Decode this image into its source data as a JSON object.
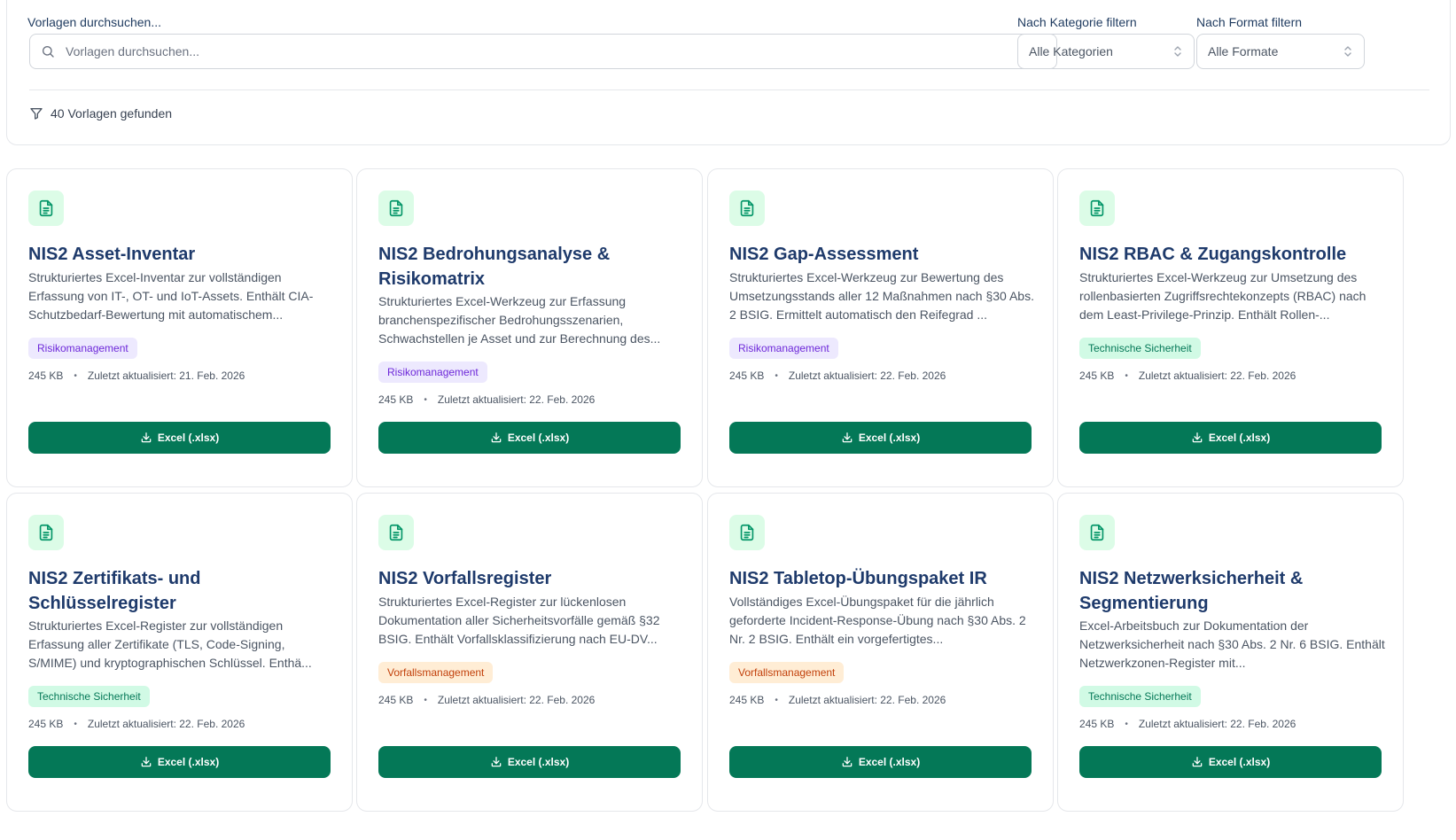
{
  "filters": {
    "search_label": "Vorlagen durchsuchen...",
    "search_placeholder": "Vorlagen durchsuchen...",
    "category_label": "Nach Kategorie filtern",
    "category_value": "Alle Kategorien",
    "format_label": "Nach Format filtern",
    "format_value": "Alle Formate",
    "result_count": "40 Vorlagen gefunden"
  },
  "colors": {
    "primary_button": "#047857",
    "title": "#1e3a6b",
    "icon_bg": "#dcfce7"
  },
  "cards": [
    {
      "title": "NIS2 Asset-Inventar",
      "description": "Strukturiertes Excel-Inventar zur vollständigen Erfassung von IT-, OT- und IoT-Assets. Enthält CIA-Schutzbedarf-Bewertung mit automatischem...",
      "category": "Risikomanagement",
      "size": "245 KB",
      "updated": "Zuletzt aktualisiert: 21. Feb. 2026",
      "button": "Excel (.xlsx)"
    },
    {
      "title": "NIS2 Bedrohungsanalyse & Risikomatrix",
      "description": "Strukturiertes Excel-Werkzeug zur Erfassung branchenspezifischer Bedrohungsszenarien, Schwachstellen je Asset und zur Berechnung des...",
      "category": "Risikomanagement",
      "size": "245 KB",
      "updated": "Zuletzt aktualisiert: 22. Feb. 2026",
      "button": "Excel (.xlsx)"
    },
    {
      "title": "NIS2 Gap-Assessment",
      "description": "Strukturiertes Excel-Werkzeug zur Bewertung des Umsetzungsstands aller 12 Maßnahmen nach §30 Abs. 2 BSIG. Ermittelt automatisch den Reifegrad ...",
      "category": "Risikomanagement",
      "size": "245 KB",
      "updated": "Zuletzt aktualisiert: 22. Feb. 2026",
      "button": "Excel (.xlsx)"
    },
    {
      "title": "NIS2 RBAC & Zugangskontrolle",
      "description": "Strukturiertes Excel-Werkzeug zur Umsetzung des rollenbasierten Zugriffsrechtekonzepts (RBAC) nach dem Least-Privilege-Prinzip. Enthält Rollen-...",
      "category": "Technische Sicherheit",
      "size": "245 KB",
      "updated": "Zuletzt aktualisiert: 22. Feb. 2026",
      "button": "Excel (.xlsx)"
    },
    {
      "title": "NIS2 Zertifikats- und Schlüsselregister",
      "description": "Strukturiertes Excel-Register zur vollständigen Erfassung aller Zertifikate (TLS, Code-Signing, S/MIME) und kryptographischen Schlüssel. Enthä...",
      "category": "Technische Sicherheit",
      "size": "245 KB",
      "updated": "Zuletzt aktualisiert: 22. Feb. 2026",
      "button": "Excel (.xlsx)"
    },
    {
      "title": "NIS2 Vorfallsregister",
      "description": "Strukturiertes Excel-Register zur lückenlosen Dokumentation aller Sicherheitsvorfälle gemäß §32 BSIG. Enthält Vorfallsklassifizierung nach EU-DV...",
      "category": "Vorfallsmanagement",
      "size": "245 KB",
      "updated": "Zuletzt aktualisiert: 22. Feb. 2026",
      "button": "Excel (.xlsx)"
    },
    {
      "title": "NIS2 Tabletop-Übungspaket IR",
      "description": "Vollständiges Excel-Übungspaket für die jährlich geforderte Incident-Response-Übung nach §30 Abs. 2 Nr. 2 BSIG. Enthält ein vorgefertigtes...",
      "category": "Vorfallsmanagement",
      "size": "245 KB",
      "updated": "Zuletzt aktualisiert: 22. Feb. 2026",
      "button": "Excel (.xlsx)"
    },
    {
      "title": "NIS2 Netzwerksicherheit & Segmentierung",
      "description": "Excel-Arbeitsbuch zur Dokumentation der Netzwerksicherheit nach §30 Abs. 2 Nr. 6 BSIG. Enthält Netzwerkzonen-Register mit...",
      "category": "Technische Sicherheit",
      "size": "245 KB",
      "updated": "Zuletzt aktualisiert: 22. Feb. 2026",
      "button": "Excel (.xlsx)"
    }
  ]
}
